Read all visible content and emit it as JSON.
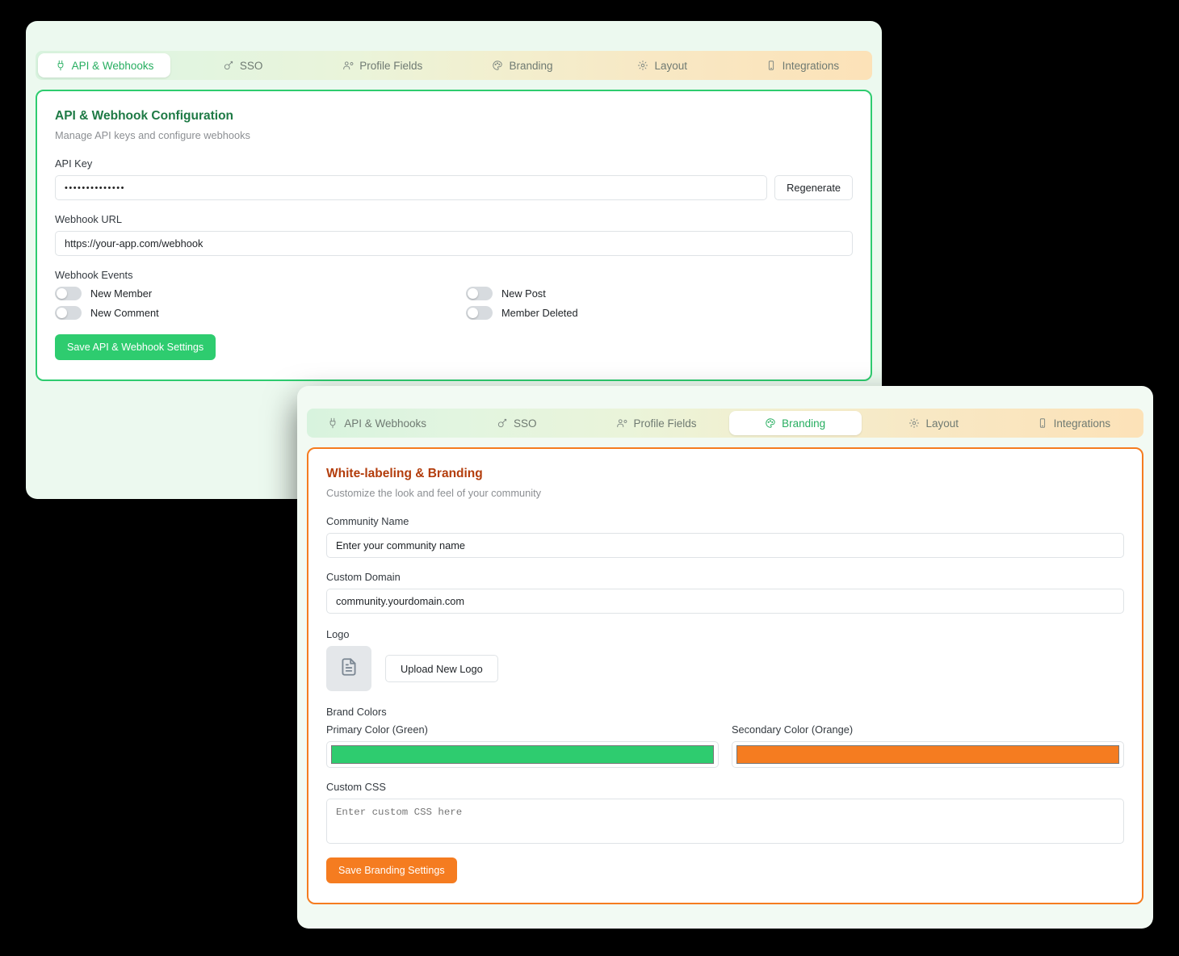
{
  "theme": {
    "primary_green": "#2ecc6f",
    "secondary_orange": "#f57c20",
    "title_green": "#1e7a45",
    "title_orange": "#b33d0c",
    "window_bg": "#ecf9ef"
  },
  "tabs": [
    {
      "label": "API & Webhooks",
      "icon": "plug-icon"
    },
    {
      "label": "SSO",
      "icon": "key-icon"
    },
    {
      "label": "Profile Fields",
      "icon": "users-icon"
    },
    {
      "label": "Branding",
      "icon": "palette-icon"
    },
    {
      "label": "Layout",
      "icon": "gear-icon"
    },
    {
      "label": "Integrations",
      "icon": "tablet-icon"
    }
  ],
  "window_api": {
    "active_tab": "API & Webhooks",
    "panel": {
      "title": "API & Webhook Configuration",
      "subtitle": "Manage API keys and configure webhooks"
    },
    "api_key": {
      "label": "API Key",
      "value": "••••••••••••••",
      "regenerate_label": "Regenerate"
    },
    "webhook_url": {
      "label": "Webhook URL",
      "value": "https://your-app.com/webhook"
    },
    "webhook_events": {
      "label": "Webhook Events",
      "items": [
        {
          "label": "New Member",
          "on": false
        },
        {
          "label": "New Post",
          "on": false
        },
        {
          "label": "New Comment",
          "on": false
        },
        {
          "label": "Member Deleted",
          "on": false
        }
      ]
    },
    "save_label": "Save API & Webhook Settings"
  },
  "window_branding": {
    "active_tab": "Branding",
    "panel": {
      "title": "White-labeling & Branding",
      "subtitle": "Customize the look and feel of your community"
    },
    "community_name": {
      "label": "Community Name",
      "placeholder": "Enter your community name"
    },
    "custom_domain": {
      "label": "Custom Domain",
      "value": "community.yourdomain.com"
    },
    "logo": {
      "label": "Logo",
      "icon": "document-icon",
      "upload_label": "Upload New Logo"
    },
    "brand_colors": {
      "label": "Brand Colors",
      "primary": {
        "label": "Primary Color (Green)",
        "value": "#2ecc6f"
      },
      "secondary": {
        "label": "Secondary Color (Orange)",
        "value": "#f57c20"
      }
    },
    "custom_css": {
      "label": "Custom CSS",
      "placeholder": "Enter custom CSS here"
    },
    "save_label": "Save Branding Settings"
  }
}
